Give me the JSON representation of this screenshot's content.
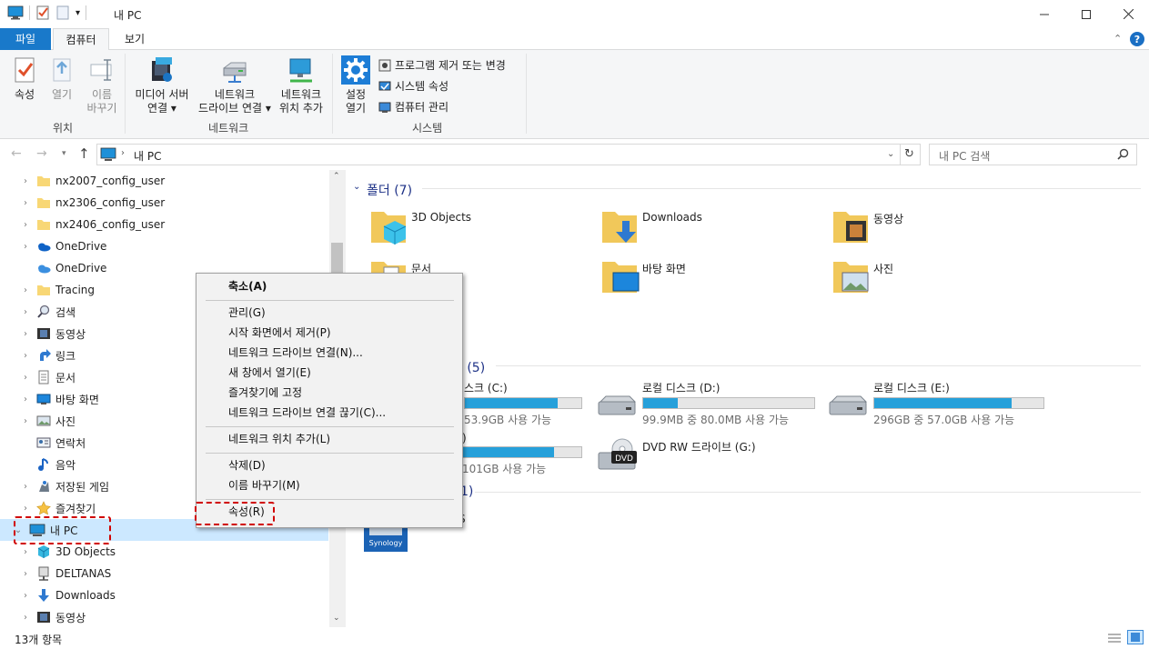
{
  "window": {
    "title": "내 PC",
    "qat_dropdown": "▾"
  },
  "tabs": {
    "file": "파일",
    "computer": "컴퓨터",
    "view": "보기"
  },
  "ribbon": {
    "location": {
      "properties": "속성",
      "open": "열기",
      "rename_l1": "이름",
      "rename_l2": "바꾸기",
      "label": "위치"
    },
    "network": {
      "media_l1": "미디어 서버",
      "media_l2": "연결 ▾",
      "drive_l1": "네트워크",
      "drive_l2": "드라이브 연결 ▾",
      "loc_l1": "네트워크",
      "loc_l2": "위치 추가",
      "label": "네트워크"
    },
    "system": {
      "settings_l1": "설정",
      "settings_l2": "열기",
      "uninstall": "프로그램 제거 또는 변경",
      "sysprops": "시스템 속성",
      "manage": "컴퓨터 관리",
      "label": "시스템"
    }
  },
  "address": {
    "path": "내 PC",
    "search_placeholder": "내 PC 검색"
  },
  "nav": [
    {
      "label": "nx2007_config_user"
    },
    {
      "label": "nx2306_config_user"
    },
    {
      "label": "nx2406_config_user"
    },
    {
      "label": "OneDrive"
    },
    {
      "label": "OneDrive"
    },
    {
      "label": "Tracing"
    },
    {
      "label": "검색"
    },
    {
      "label": "동영상"
    },
    {
      "label": "링크"
    },
    {
      "label": "문서"
    },
    {
      "label": "바탕 화면"
    },
    {
      "label": "사진"
    },
    {
      "label": "연락처"
    },
    {
      "label": "음악"
    },
    {
      "label": "저장된 게임"
    },
    {
      "label": "즐겨찾기"
    },
    {
      "label": "내 PC"
    },
    {
      "label": "3D Objects"
    },
    {
      "label": "DELTANAS"
    },
    {
      "label": "Downloads"
    },
    {
      "label": "동영상"
    }
  ],
  "content": {
    "folders_header": "폴더 (7)",
    "folders": [
      "3D Objects",
      "Downloads",
      "동영상",
      "문서",
      "바탕 화면",
      "사진"
    ],
    "devices_header_tail": "브 (5)",
    "drives": [
      {
        "name": "로컬 디스크 (C:)",
        "name_visible": "스크 (C:)",
        "info": "53.9GB 사용 가능",
        "used": 0.8
      },
      {
        "name": "로컬 디스크 (D:)",
        "info": "99.9MB 중 80.0MB 사용 가능",
        "used": 0.2
      },
      {
        "name": "로컬 디스크 (E:)",
        "info": "296GB 중 57.0GB 사용 가능",
        "used": 0.81
      },
      {
        "name_visible": ")",
        "info": "101GB 사용 가능",
        "used": 0.71
      },
      {
        "name": "DVD RW 드라이브 (G:)"
      }
    ],
    "network_header_tail": "1)",
    "network_item_tail": "S",
    "synology": "Synology"
  },
  "context_menu": {
    "items": [
      "축소(A)",
      "관리(G)",
      "시작 화면에서 제거(P)",
      "네트워크 드라이브 연결(N)...",
      "새 창에서 열기(E)",
      "즐겨찾기에 고정",
      "네트워크 드라이브 연결 끊기(C)...",
      "네트워크 위치 추가(L)",
      "삭제(D)",
      "이름 바꾸기(M)",
      "속성(R)"
    ]
  },
  "status": {
    "count": "13개 항목"
  },
  "colors": {
    "accent": "#1979ca",
    "selection": "#cce8ff",
    "drive_bar": "#26a0da",
    "highlight": "#d00000"
  }
}
